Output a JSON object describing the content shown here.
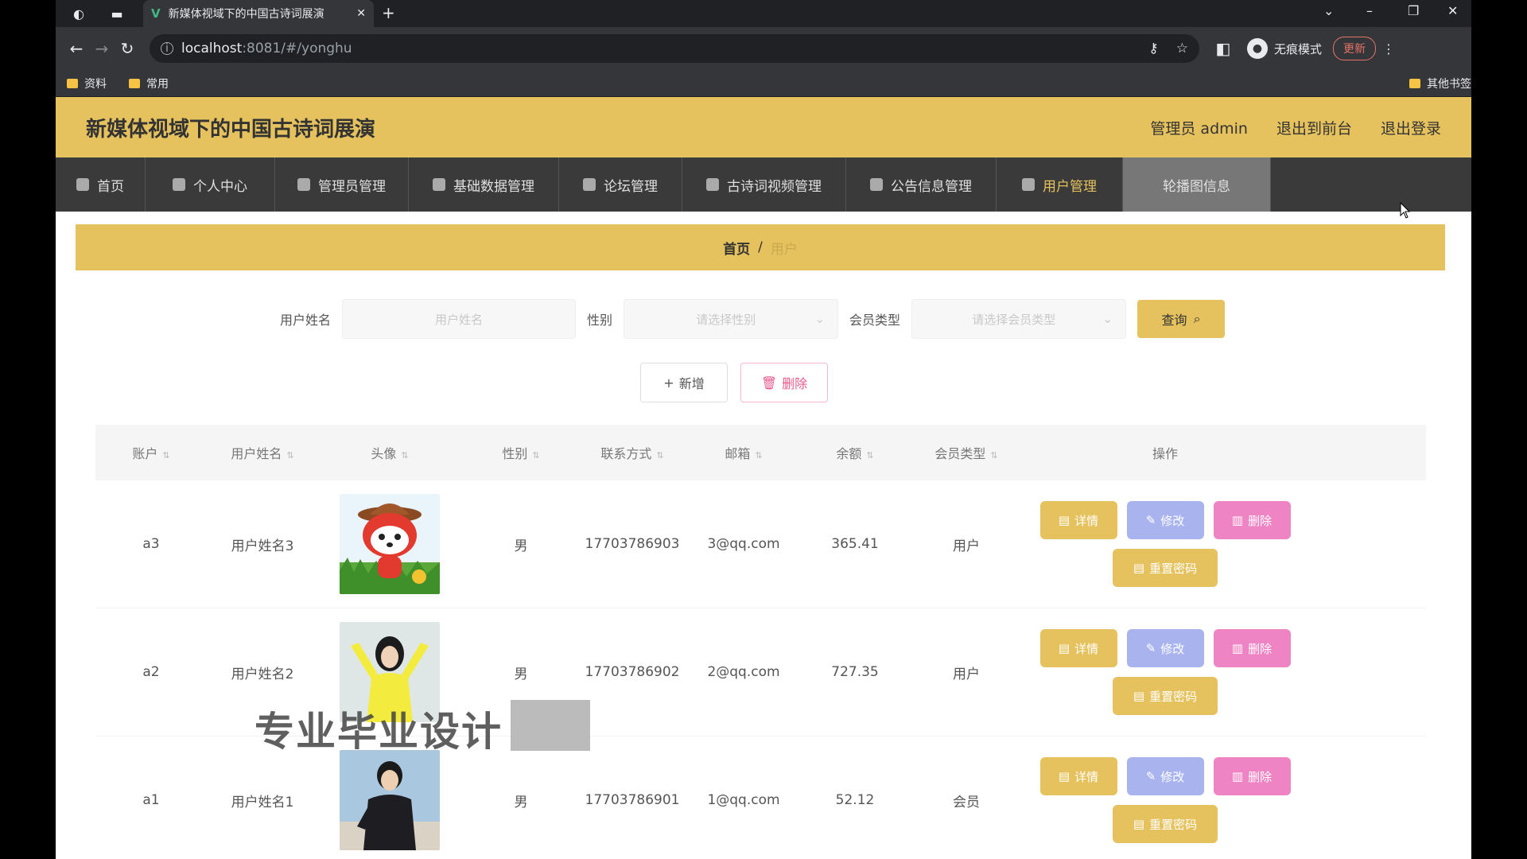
{
  "browser": {
    "tab_title": "新媒体视域下的中国古诗词展演",
    "url_host": "localhost",
    "url_path": ":8081/#/yonghu",
    "incognito_label": "无痕模式",
    "update_label": "更新",
    "bookmarks": [
      "资料",
      "常用"
    ],
    "other_bookmarks": "其他书签"
  },
  "header": {
    "title": "新媒体视域下的中国古诗词展演",
    "admin": "管理员 admin",
    "to_front": "退出到前台",
    "logout": "退出登录"
  },
  "menu": [
    {
      "label": "首页"
    },
    {
      "label": "个人中心"
    },
    {
      "label": "管理员管理"
    },
    {
      "label": "基础数据管理"
    },
    {
      "label": "论坛管理"
    },
    {
      "label": "古诗词视频管理"
    },
    {
      "label": "公告信息管理"
    },
    {
      "label": "用户管理"
    },
    {
      "label": "轮播图信息"
    }
  ],
  "breadcrumb": {
    "home": "首页",
    "sep": "/",
    "current": "用户"
  },
  "search": {
    "name_label": "用户姓名",
    "name_placeholder": "用户姓名",
    "sex_label": "性别",
    "sex_placeholder": "请选择性别",
    "member_label": "会员类型",
    "member_placeholder": "请选择会员类型",
    "query": "查询"
  },
  "actions": {
    "add": "新增",
    "delete": "删除"
  },
  "table": {
    "headers": [
      "账户",
      "用户姓名",
      "头像",
      "性别",
      "联系方式",
      "邮箱",
      "余额",
      "会员类型",
      "操作"
    ],
    "rows": [
      {
        "account": "a3",
        "name": "用户姓名3",
        "sex": "男",
        "phone": "17703786903",
        "email": "3@qq.com",
        "balance": "365.41",
        "member": "用户"
      },
      {
        "account": "a2",
        "name": "用户姓名2",
        "sex": "男",
        "phone": "17703786902",
        "email": "2@qq.com",
        "balance": "727.35",
        "member": "用户"
      },
      {
        "account": "a1",
        "name": "用户姓名1",
        "sex": "男",
        "phone": "17703786901",
        "email": "1@qq.com",
        "balance": "52.12",
        "member": "会员"
      }
    ],
    "ops": {
      "detail": "详情",
      "edit": "修改",
      "delete": "删除",
      "reset": "重置密码"
    }
  },
  "watermark": "专业毕业设计"
}
